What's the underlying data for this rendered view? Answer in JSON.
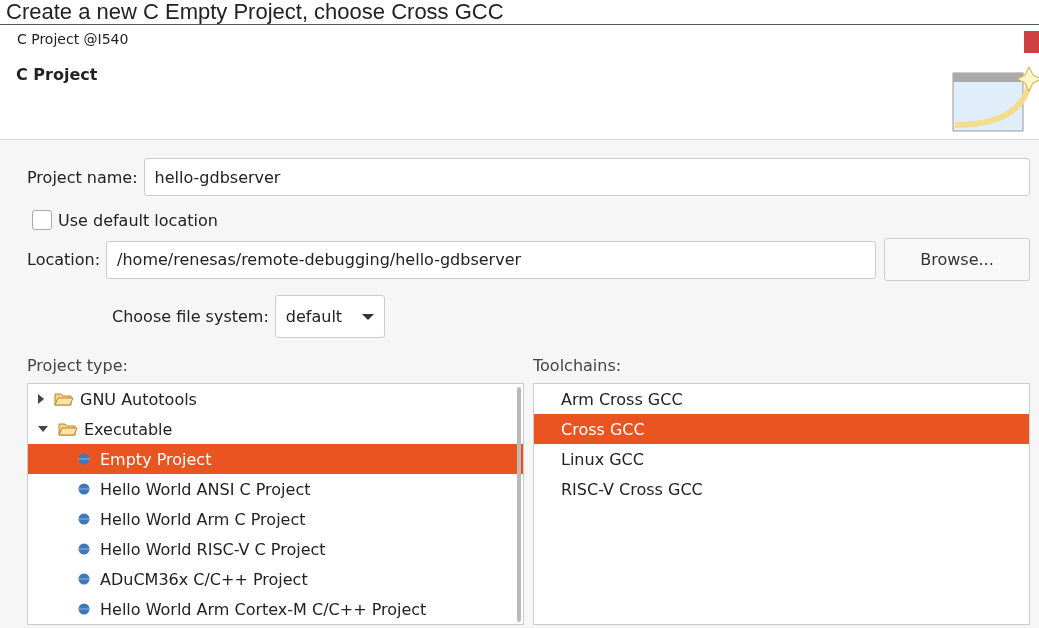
{
  "caption": "Create a new C Empty Project, choose Cross GCC",
  "window": {
    "title": "C Project @I540"
  },
  "header": {
    "title": "C Project"
  },
  "project_name": {
    "label": "Project name:",
    "value": "hello-gdbserver"
  },
  "use_default_location": {
    "label": "Use default location",
    "checked": false
  },
  "location": {
    "label": "Location:",
    "value": "/home/renesas/remote-debugging/hello-gdbserver",
    "button": "Browse..."
  },
  "file_system": {
    "label": "Choose file system:",
    "value": "default"
  },
  "project_type": {
    "label": "Project type:",
    "items": [
      {
        "label": "GNU Autotools",
        "kind": "folder",
        "expanded": false,
        "selected": false
      },
      {
        "label": "Executable",
        "kind": "folder",
        "expanded": true,
        "selected": false,
        "children": [
          {
            "label": "Empty Project",
            "kind": "leaf",
            "selected": true
          },
          {
            "label": "Hello World ANSI C Project",
            "kind": "leaf",
            "selected": false
          },
          {
            "label": "Hello World Arm C Project",
            "kind": "leaf",
            "selected": false
          },
          {
            "label": "Hello World RISC-V C Project",
            "kind": "leaf",
            "selected": false
          },
          {
            "label": "ADuCM36x C/C++ Project",
            "kind": "leaf",
            "selected": false
          },
          {
            "label": "Hello World Arm Cortex-M C/C++ Project",
            "kind": "leaf",
            "selected": false
          }
        ]
      }
    ]
  },
  "toolchains": {
    "label": "Toolchains:",
    "items": [
      {
        "label": "Arm Cross GCC",
        "selected": false
      },
      {
        "label": "Cross GCC",
        "selected": true
      },
      {
        "label": "Linux GCC",
        "selected": false
      },
      {
        "label": "RISC-V Cross GCC",
        "selected": false
      }
    ]
  }
}
